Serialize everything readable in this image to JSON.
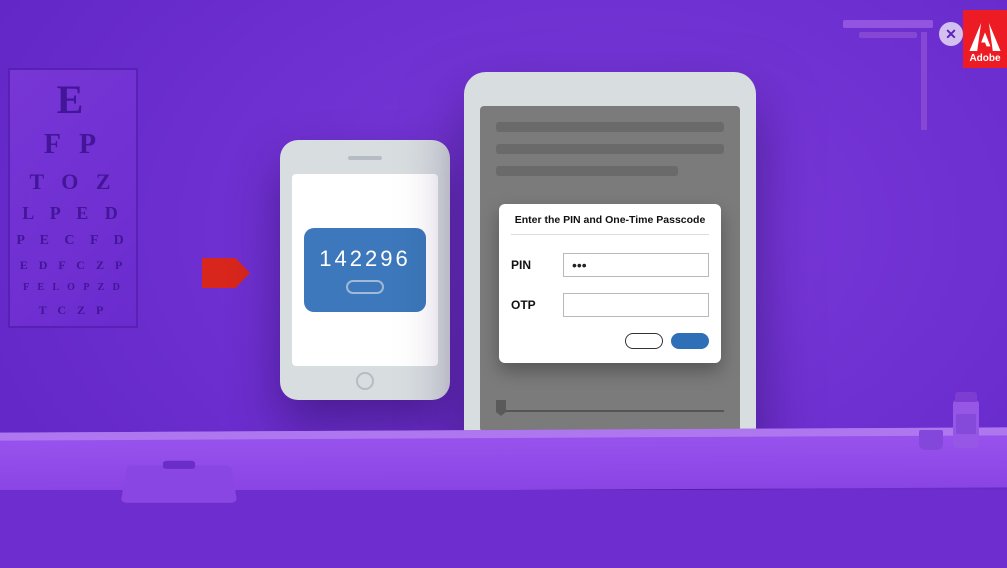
{
  "eye_chart": {
    "rows": [
      "E",
      "F P",
      "T O Z",
      "L P E D",
      "P E C F D",
      "E D F C Z P",
      "F E L O P Z D",
      "T C Z P"
    ]
  },
  "phone": {
    "otp_code": "142296"
  },
  "dialog": {
    "title": "Enter the PIN and One-Time Passcode",
    "pin_label": "PIN",
    "pin_value": "•••",
    "otp_label": "OTP",
    "otp_value": ""
  },
  "badge": {
    "label": "Adobe"
  },
  "colors": {
    "accent": "#6a2fc9",
    "code_card": "#3c78bb",
    "arrow": "#d9261c",
    "adobe": "#ed1c24",
    "primary_btn": "#2f6fb8"
  }
}
